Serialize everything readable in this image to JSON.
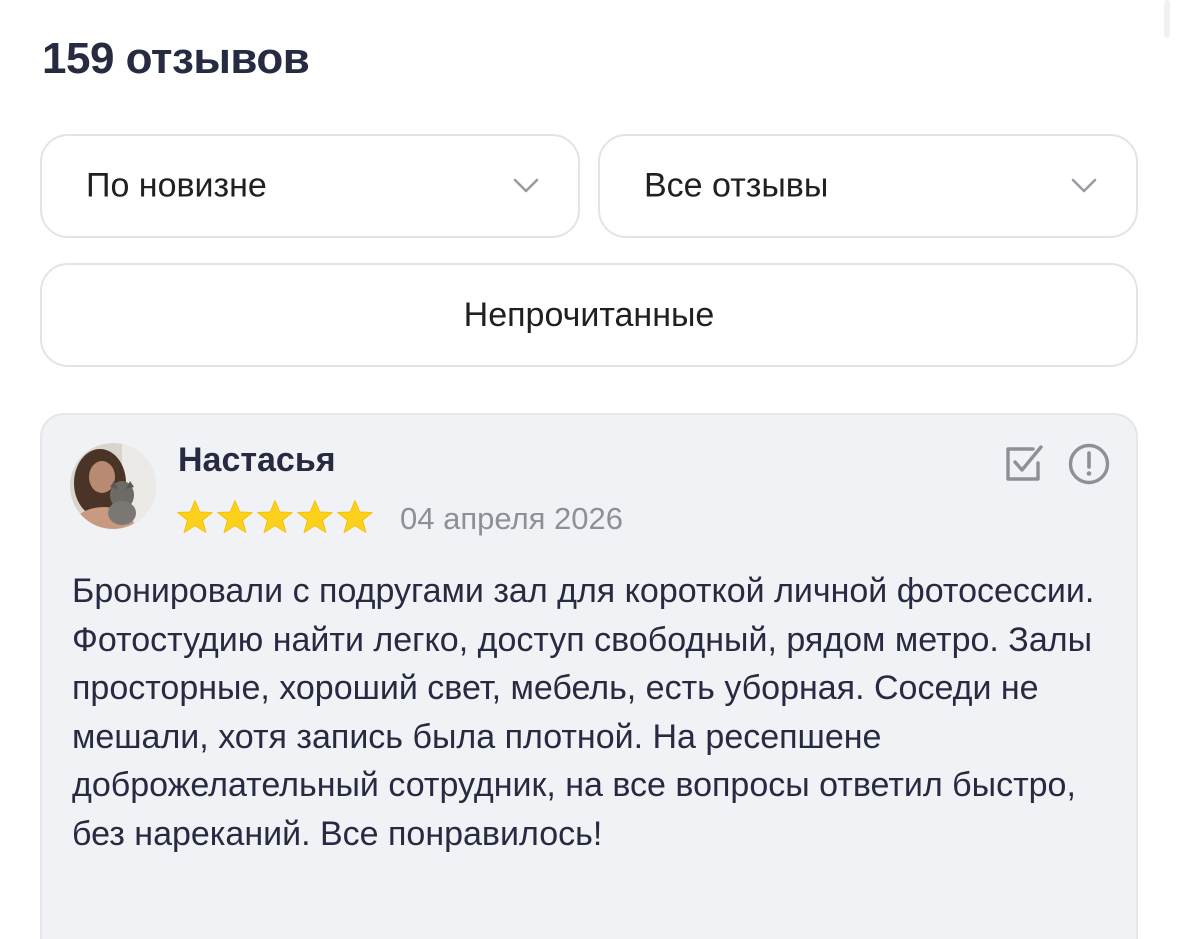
{
  "header": {
    "title": "159 отзывов"
  },
  "filters": {
    "sort": {
      "value": "По новизне",
      "icon": "chevron-down-icon"
    },
    "type": {
      "value": "Все отзывы",
      "icon": "chevron-down-icon"
    },
    "unread_label": "Непрочитанные"
  },
  "review": {
    "author": "Настасья",
    "rating": 5,
    "max_rating": 5,
    "date": "04 апреля 2026",
    "text": "Бронировали с подругами зал для короткой личной фотосессии. Фотостудию найти легко, доступ свободный, рядом метро. Залы просторные, хороший свет, мебель, есть уборная. Соседи не мешали, хотя запись была плотной. На ресепшене доброжелательный сотрудник, на все вопросы ответил быстро, без нареканий. Все понравилось!",
    "actions": [
      "check-square-icon",
      "exclamation-circle-icon"
    ]
  },
  "colors": {
    "title": "#262b42",
    "star": "#fcd11d",
    "date": "#8f8f97",
    "card_background": "#f1f2f6",
    "border": "#e4e4e8",
    "icon": "#8f8f97"
  }
}
